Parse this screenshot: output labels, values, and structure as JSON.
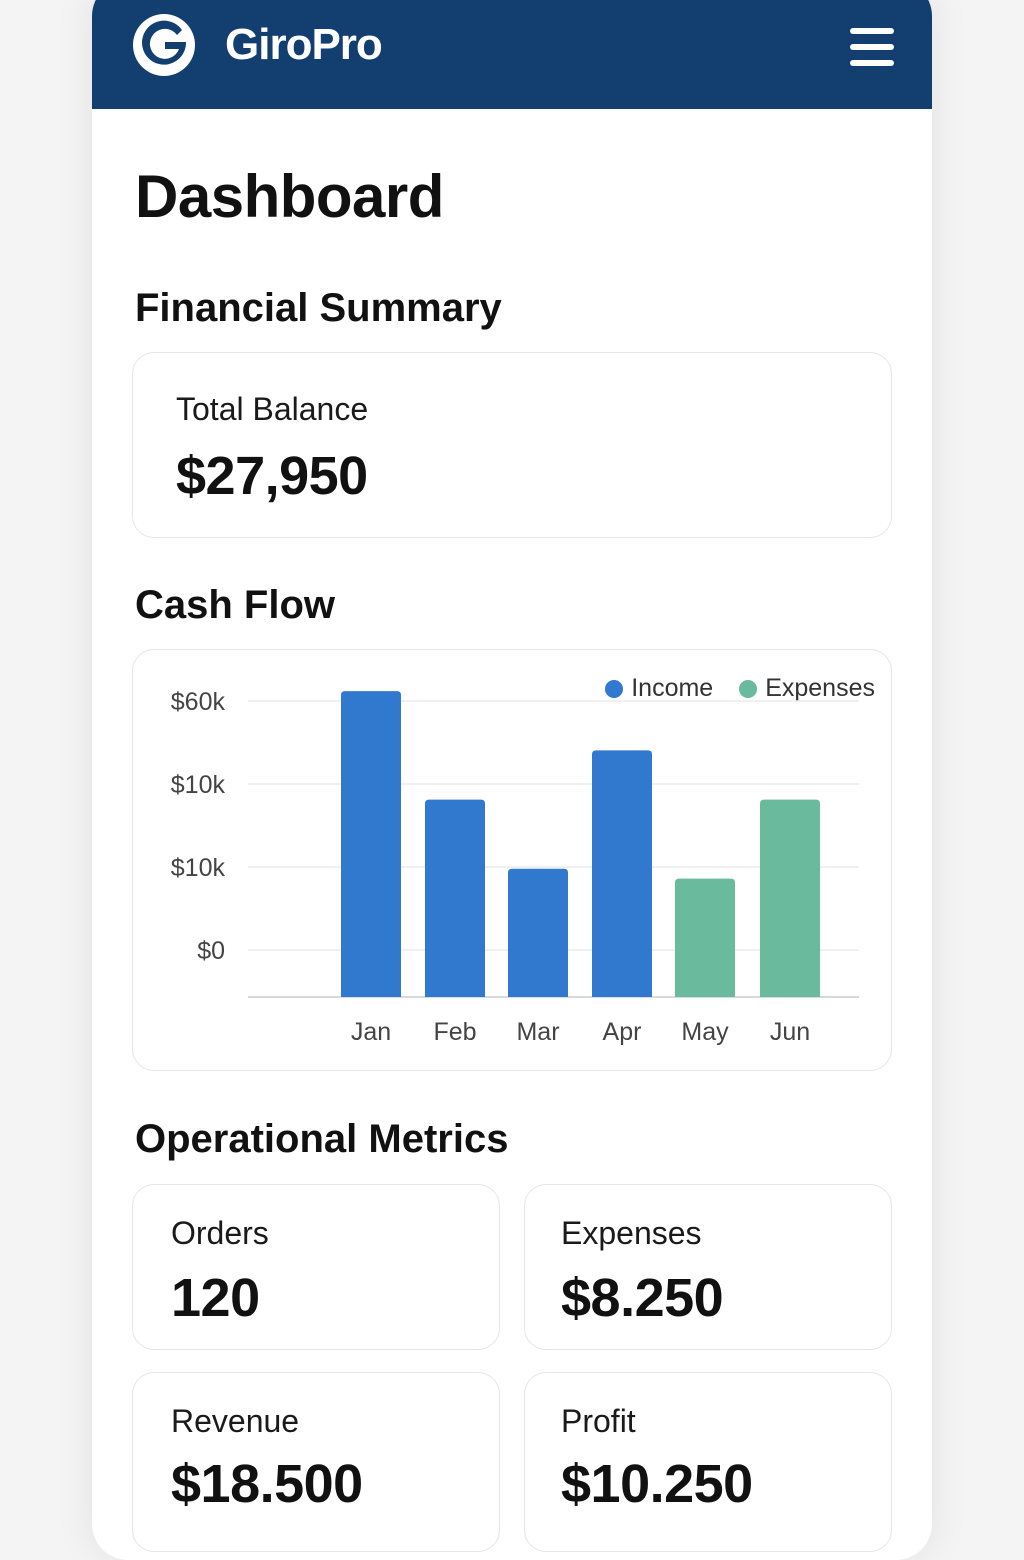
{
  "app": {
    "brand": "GiroPro",
    "logo_letter": "G",
    "menu_icon": "hamburger-menu-icon"
  },
  "page": {
    "title": "Dashboard"
  },
  "financial_summary": {
    "title": "Financial Summary",
    "total_balance_label": "Total Balance",
    "total_balance_value": "$27,950"
  },
  "cash_flow": {
    "title": "Cash Flow"
  },
  "operational_metrics": {
    "title": "Operational Metrics",
    "cards": [
      {
        "label": "Orders",
        "value": "120"
      },
      {
        "label": "Expenses",
        "value": "$8.250"
      },
      {
        "label": "Revenue",
        "value": "$18.500"
      },
      {
        "label": "Profit",
        "value": "$10.250"
      }
    ]
  },
  "colors": {
    "header": "#123f70",
    "income": "#3178cf",
    "expenses": "#6abb9d"
  },
  "chart_data": {
    "type": "bar",
    "title": "Cash Flow",
    "categories": [
      "Jan",
      "Feb",
      "Mar",
      "Apr",
      "May",
      "Jun"
    ],
    "y_tick_labels": [
      "$0",
      "$10k",
      "$10k",
      "$60k"
    ],
    "tick_levels": [
      0,
      1,
      2,
      3
    ],
    "ylim": [
      0,
      3
    ],
    "grid": true,
    "legend_position": "top-right",
    "series": [
      {
        "name": "Income",
        "color": "#3178cf",
        "values": [
          3.1,
          2.0,
          1.3,
          2.5,
          null,
          null
        ]
      },
      {
        "name": "Expenses",
        "color": "#6abb9d",
        "values": [
          null,
          null,
          null,
          null,
          1.2,
          2.0
        ]
      }
    ]
  }
}
